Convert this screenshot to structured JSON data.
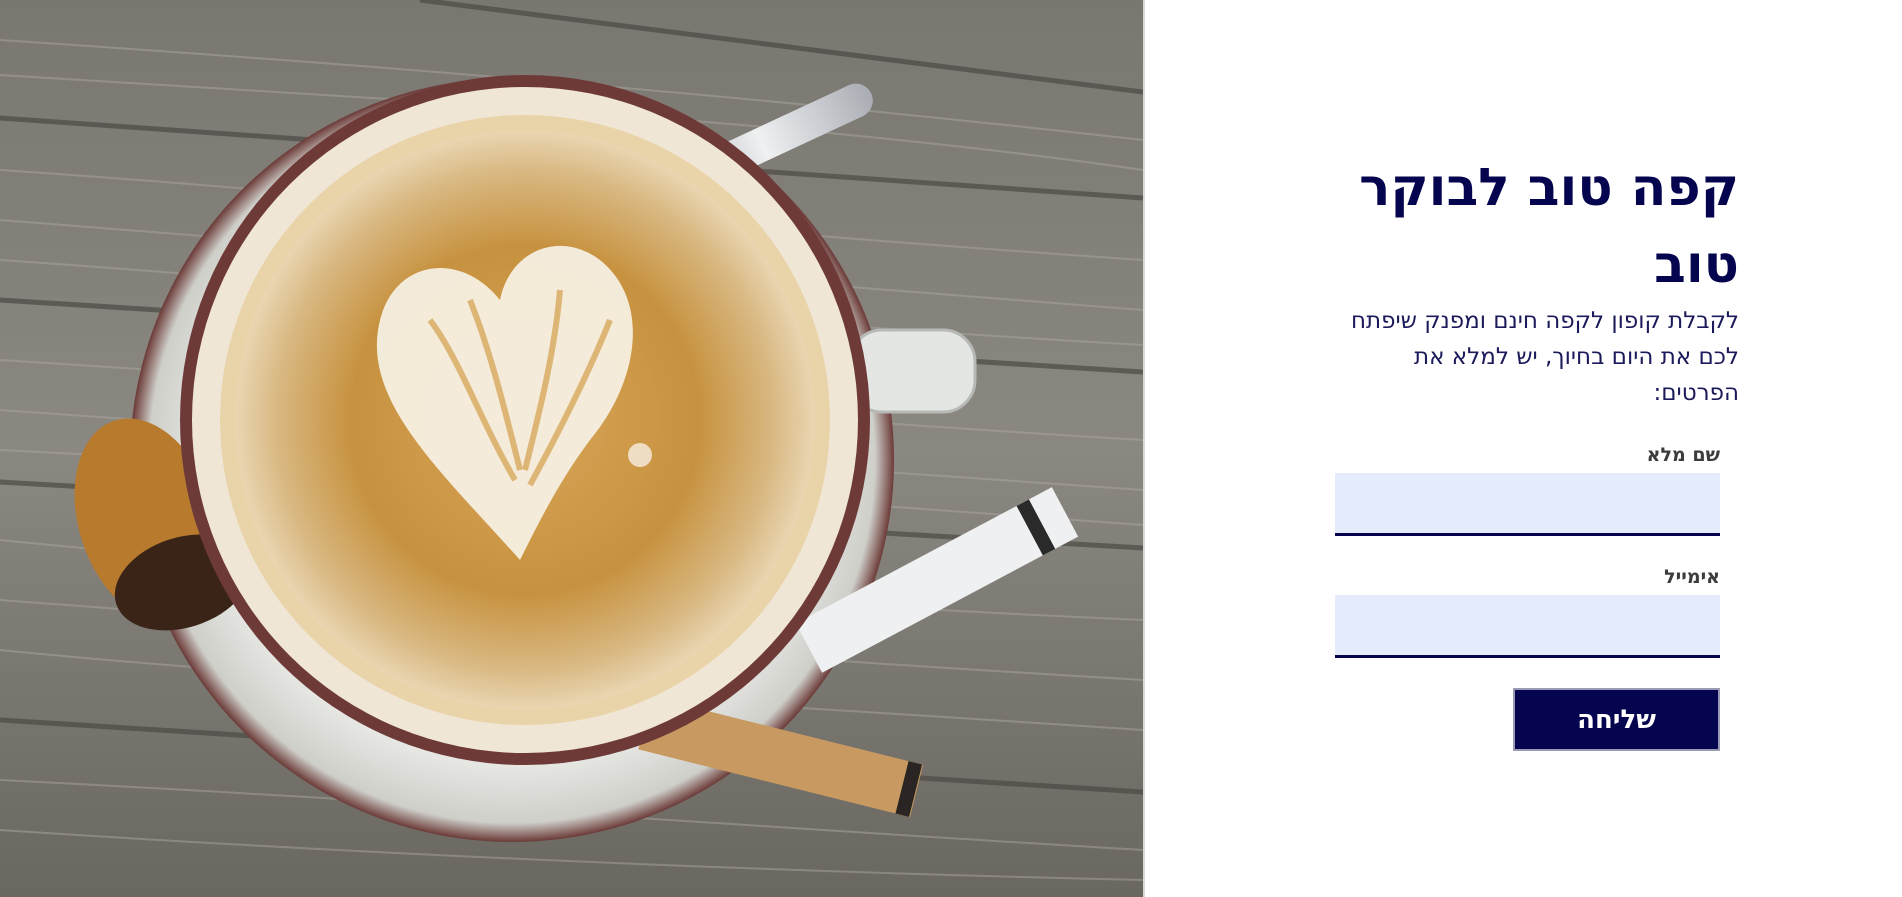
{
  "hero": {
    "image": "coffee-latte-art-photo"
  },
  "signup": {
    "headline": "קפה טוב לבוקר טוב",
    "intro": "לקבלת קופון לקפה חינם ומפנק שיפתח לכם את היום בחיוך, יש למלא את הפרטים:",
    "name_label": "שם מלא",
    "name_value": "",
    "email_label": "אימייל",
    "email_value": "",
    "submit_label": "שליחה"
  },
  "colors": {
    "brand_navy": "#05044f",
    "input_bg": "#e4ecfb",
    "background": "#ffffff"
  }
}
